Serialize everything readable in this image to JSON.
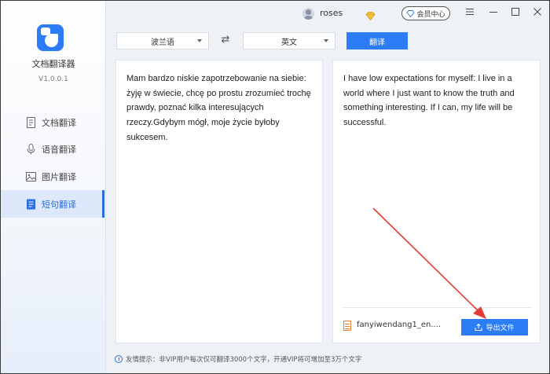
{
  "app": {
    "name": "文档翻译器",
    "version": "V1.0.0.1"
  },
  "sidebar": {
    "items": [
      {
        "label": "文档翻译",
        "icon": "document-icon",
        "active": false
      },
      {
        "label": "语音翻译",
        "icon": "microphone-icon",
        "active": false
      },
      {
        "label": "图片翻译",
        "icon": "image-icon",
        "active": false
      },
      {
        "label": "短句翻译",
        "icon": "sentence-icon",
        "active": true
      }
    ]
  },
  "titlebar": {
    "username": "roses",
    "vip_label": "会员中心"
  },
  "toolbar": {
    "source_lang": "波兰语",
    "target_lang": "英文",
    "translate_label": "翻译"
  },
  "source": {
    "text": "Mam bardzo niskie zapotrzebowanie na siebie: żyję w świecie, chcę po prostu zrozumieć trochę prawdy, poznać kilka interesujących rzeczy.Gdybym mógł, moje życie byłoby sukcesem."
  },
  "target": {
    "text": "I have low expectations for myself: I live in a world where I just want to know the truth and something interesting. If I can, my life will be successful.",
    "file_name": "fanyiwendang1_en....",
    "export_label": "导出文件"
  },
  "footer": {
    "tip": "友情提示：非VIP用户每次仅可翻译3000个文字，开通VIP将可增加至3万个文字"
  },
  "colors": {
    "accent": "#2c7cf6",
    "annotation_arrow": "#e53935",
    "file_icon": "#e07b2a"
  }
}
